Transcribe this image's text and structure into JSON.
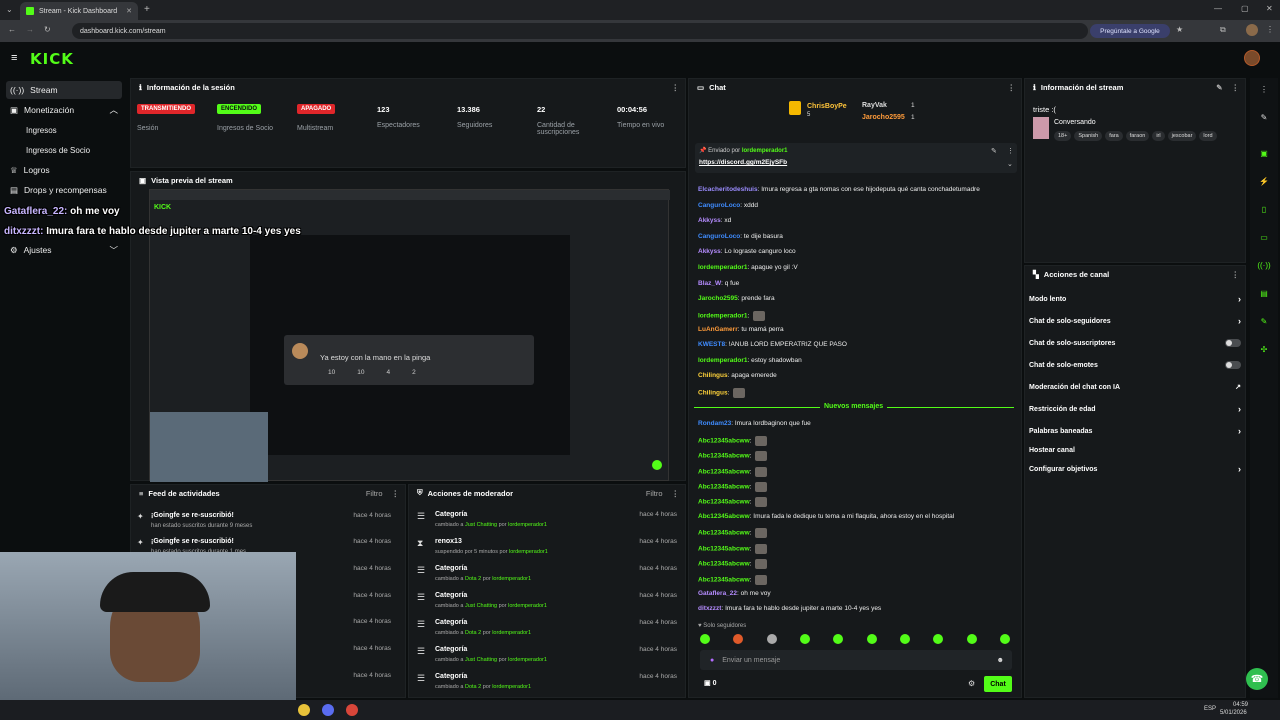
{
  "browser": {
    "tab_title": "Stream - Kick Dashboard",
    "url": "dashboard.kick.com/stream",
    "ask_google": "Pregúntale a Google"
  },
  "app": {
    "logo": "KICK"
  },
  "sidebar": {
    "items": [
      {
        "label": "Stream",
        "icon": "broadcast-icon"
      },
      {
        "label": "Monetización",
        "icon": "money-icon"
      },
      {
        "label": "Ingresos"
      },
      {
        "label": "Ingresos de Socio"
      },
      {
        "label": "Logros",
        "icon": "trophy-icon"
      },
      {
        "label": "Drops y recompensas",
        "icon": "gift-icon"
      },
      {
        "label": "Ajustes",
        "icon": "gear-icon"
      }
    ]
  },
  "overlay": {
    "line1_user": "Gataflera_22:",
    "line1_text": " oh me voy",
    "line2_user": "ditxzzzt:",
    "line2_text": " Imura fara te hablo desde jupiter a marte 10-4 yes yes"
  },
  "session": {
    "title": "Información de la sesión",
    "badges": [
      {
        "label": "TRANSMITIENDO",
        "sub": "Sesión",
        "color": "#e0262a"
      },
      {
        "label": "ENCENDIDO",
        "sub": "Ingresos de Socio",
        "color": "#53fc18"
      },
      {
        "label": "APAGADO",
        "sub": "Multistream",
        "color": "#e0262a"
      }
    ],
    "stats": [
      {
        "value": "123",
        "label": "Espectadores"
      },
      {
        "value": "13.386",
        "label": "Seguidores"
      },
      {
        "value": "22",
        "label": "Cantidad de suscripciones"
      },
      {
        "value": "00:04:56",
        "label": "Tiempo en vivo"
      }
    ]
  },
  "preview": {
    "title": "Vista previa del stream",
    "card_text": "Ya estoy con la mano en la pinga",
    "card_counts": [
      "10",
      "10",
      "4",
      "2"
    ]
  },
  "activity": {
    "title": "Feed de actividades",
    "filter": "Filtro",
    "items": [
      {
        "title": "¡Goingfe se re-suscribió!",
        "sub": "han estado suscritos durante 9 meses",
        "time": "hace 4 horas"
      },
      {
        "title": "¡Goingfe se re-suscribió!",
        "sub": "han estado suscritos durante 1 mes",
        "time": "hace 4 horas"
      },
      {
        "title": "",
        "sub": "",
        "time": "hace 4 horas"
      },
      {
        "title": "",
        "sub": "",
        "time": "hace 4 horas"
      },
      {
        "title": "",
        "sub": "",
        "time": "hace 4 horas"
      },
      {
        "title": "",
        "sub": "",
        "time": "hace 4 horas"
      },
      {
        "title": "",
        "sub": "",
        "time": "hace 4 horas"
      }
    ]
  },
  "mod_actions": {
    "title": "Acciones de moderador",
    "filter": "Filtro",
    "items": [
      {
        "title": "Categoría",
        "pre": "cambiado a ",
        "target": "Just Chatting",
        "mid": " por ",
        "by": "lordemperador1",
        "time": "hace 4 horas",
        "icon": "list-icon"
      },
      {
        "title": "renox13",
        "pre": "suspendido por 5 minutos por ",
        "target": "",
        "mid": "",
        "by": "lordemperador1",
        "time": "hace 4 horas",
        "icon": "hourglass-icon"
      },
      {
        "title": "Categoría",
        "pre": "cambiado a ",
        "target": "Dota 2",
        "mid": " por ",
        "by": "lordemperador1",
        "time": "hace 4 horas",
        "icon": "list-icon"
      },
      {
        "title": "Categoría",
        "pre": "cambiado a ",
        "target": "Just Chatting",
        "mid": " por ",
        "by": "lordemperador1",
        "time": "hace 4 horas",
        "icon": "list-icon"
      },
      {
        "title": "Categoría",
        "pre": "cambiado a ",
        "target": "Dota 2",
        "mid": " por ",
        "by": "lordemperador1",
        "time": "hace 4 horas",
        "icon": "list-icon"
      },
      {
        "title": "Categoría",
        "pre": "cambiado a ",
        "target": "Just Chatting",
        "mid": " por ",
        "by": "lordemperador1",
        "time": "hace 4 horas",
        "icon": "list-icon"
      },
      {
        "title": "Categoría",
        "pre": "cambiado a ",
        "target": "Dota 2",
        "mid": " por ",
        "by": "lordemperador1",
        "time": "hace 4 horas",
        "icon": "list-icon"
      }
    ]
  },
  "chat": {
    "title": "Chat",
    "top_gifters": [
      {
        "name": "ChrisBoyPe",
        "count": "5"
      },
      {
        "name": "RayVak",
        "count": "1"
      },
      {
        "name": "Jarocho2595",
        "count": "1"
      }
    ],
    "pinned_by": "Enviado por",
    "pinned_user": "lordemperador1",
    "pinned_link": "https://discord.gg/m2EjySFb",
    "messages": [
      {
        "user": "Elcacheritodeshuis",
        "text": ": Imura regresa a gta nomas con ese hijodeputa qué canta conchadetumadre",
        "color": "#9b8cff"
      },
      {
        "user": "CanguroLoco",
        "text": ": xddd",
        "color": "#3f8cff"
      },
      {
        "user": "Akkyss",
        "text": ": xd",
        "color": "#b58cff"
      },
      {
        "user": "CanguroLoco",
        "text": ": te dije basura",
        "color": "#3f8cff"
      },
      {
        "user": "Akkyss",
        "text": ": Lo lograste canguro loco",
        "color": "#b58cff"
      },
      {
        "user": "lordemperador1",
        "text": ": apague yo gil :V",
        "color": "#53fc18"
      },
      {
        "user": "Blaz_W",
        "text": ": q fue",
        "color": "#b58cff"
      },
      {
        "user": "Jarocho2595",
        "text": ": prende fara",
        "color": "#53fc18"
      },
      {
        "user": "lordemperador1",
        "text": ": ",
        "color": "#53fc18"
      },
      {
        "user": "LuAnGamerr",
        "text": ": tu mamá perra",
        "color": "#ff9b3a"
      },
      {
        "user": "KWEST8",
        "text": ": !ANUB LORD EMPERATRIZ QUE PASO",
        "color": "#3f8cff"
      },
      {
        "user": "lordemperador1",
        "text": ": estoy shadowban",
        "color": "#53fc18"
      },
      {
        "user": "Chilingus",
        "text": ": apaga emerede",
        "color": "#ffd23a"
      },
      {
        "user": "Chilingus",
        "text": ": ",
        "color": "#ffd23a"
      }
    ],
    "new_messages": "Nuevos mensajes",
    "messages2": [
      {
        "user": "Rondam23",
        "text": ": Imura lordbaginon que fue",
        "color": "#3f8cff"
      },
      {
        "user": "Abc12345abcww",
        "text": ": ",
        "color": "#53fc18"
      },
      {
        "user": "Abc12345abcww",
        "text": ": ",
        "color": "#53fc18"
      },
      {
        "user": "Abc12345abcww",
        "text": ": ",
        "color": "#53fc18"
      },
      {
        "user": "Abc12345abcww",
        "text": ": ",
        "color": "#53fc18"
      },
      {
        "user": "Abc12345abcww",
        "text": ": ",
        "color": "#53fc18"
      },
      {
        "user": "Abc12345abcww",
        "text": ": Imura fada le dedique tu tema a mi flaquita, ahora estoy en el hospital",
        "color": "#53fc18"
      },
      {
        "user": "Abc12345abcww",
        "text": ": ",
        "color": "#53fc18"
      },
      {
        "user": "Abc12345abcww",
        "text": ": ",
        "color": "#53fc18"
      },
      {
        "user": "Abc12345abcww",
        "text": ": ",
        "color": "#53fc18"
      },
      {
        "user": "Abc12345abcww",
        "text": ": ",
        "color": "#53fc18"
      },
      {
        "user": "Gataflera_22",
        "text": ": oh me voy",
        "color": "#b58cff"
      },
      {
        "user": "ditxzzzt",
        "text": ": Imura fara te hablo desde jupiter a marte 10-4 yes yes",
        "color": "#b58cff"
      }
    ],
    "followers_only": "Solo seguidores",
    "input_placeholder": "Enviar un mensaje",
    "points": "0",
    "send_label": "Chat"
  },
  "stream_info": {
    "title": "Información del stream",
    "stream_title": "triste :(",
    "category": "Conversando",
    "tags": [
      "18+",
      "Spanish",
      "fara",
      "faraon",
      "irl",
      "jescobar",
      "lord"
    ]
  },
  "channel_actions": {
    "title": "Acciones de canal",
    "items": [
      {
        "label": "Modo lento",
        "kind": "chevron"
      },
      {
        "label": "Chat de solo-seguidores",
        "kind": "chevron"
      },
      {
        "label": "Chat de solo-suscriptores",
        "kind": "toggle"
      },
      {
        "label": "Chat de solo-emotes",
        "kind": "toggle"
      },
      {
        "label": "Moderación del chat con IA",
        "kind": "external"
      },
      {
        "label": "Restricción de edad",
        "kind": "chevron"
      },
      {
        "label": "Palabras baneadas",
        "kind": "chevron"
      },
      {
        "label": "Hostear canal",
        "kind": "none"
      },
      {
        "label": "Configurar objetivos",
        "kind": "chevron"
      }
    ]
  },
  "taskbar": {
    "lang": "ESP",
    "time": "04:59",
    "date": "5/01/2026"
  }
}
